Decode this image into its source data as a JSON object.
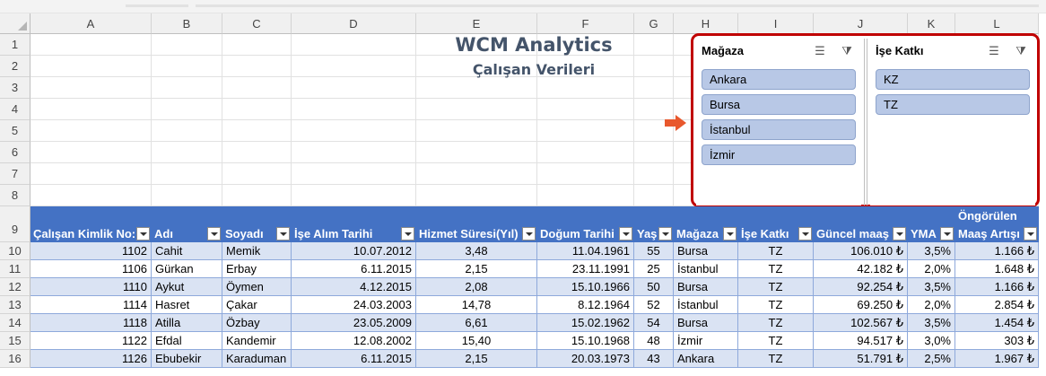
{
  "columns": [
    "A",
    "B",
    "C",
    "D",
    "E",
    "F",
    "G",
    "H",
    "I",
    "J",
    "K",
    "L"
  ],
  "rows": [
    "1",
    "2",
    "3",
    "4",
    "5",
    "6",
    "7",
    "8",
    "9",
    "10",
    "11",
    "12",
    "13",
    "14",
    "15",
    "16"
  ],
  "title": "WCM Analytics",
  "subtitle": "Çalışan Verileri",
  "slicers": [
    {
      "title": "Mağaza",
      "items": [
        "Ankara",
        "Bursa",
        "İstanbul",
        "İzmir"
      ]
    },
    {
      "title": "İşe Katkı",
      "items": [
        "KZ",
        "TZ"
      ]
    }
  ],
  "headers": [
    "Çalışan Kimlik No:",
    "Adı",
    "Soyadı",
    "İşe Alım Tarihi",
    "Hizmet Süresi(Yıl)",
    "Doğum Tarihi",
    "Yaş",
    "Mağaza",
    "İşe Katkı",
    "Güncel maaş",
    "YMA",
    "Maaş Artışı"
  ],
  "header_top_line": "Öngörülen",
  "table_rows": [
    [
      "1102",
      "Cahit",
      "Memik",
      "10.07.2012",
      "3,48",
      "11.04.1961",
      "55",
      "Bursa",
      "TZ",
      "106.010 ₺",
      "3,5%",
      "1.166 ₺"
    ],
    [
      "1106",
      "Gürkan",
      "Erbay",
      "6.11.2015",
      "2,15",
      "23.11.1991",
      "25",
      "İstanbul",
      "TZ",
      "42.182 ₺",
      "2,0%",
      "1.648 ₺"
    ],
    [
      "1110",
      "Aykut",
      "Öymen",
      "4.12.2015",
      "2,08",
      "15.10.1966",
      "50",
      "Bursa",
      "TZ",
      "92.254 ₺",
      "3,5%",
      "1.166 ₺"
    ],
    [
      "1114",
      "Hasret",
      "Çakar",
      "24.03.2003",
      "14,78",
      "8.12.1964",
      "52",
      "İstanbul",
      "TZ",
      "69.250 ₺",
      "2,0%",
      "2.854 ₺"
    ],
    [
      "1118",
      "Atilla",
      "Özbay",
      "23.05.2009",
      "6,61",
      "15.02.1962",
      "54",
      "Bursa",
      "TZ",
      "102.567 ₺",
      "3,5%",
      "1.454 ₺"
    ],
    [
      "1122",
      "Efdal",
      "Kandemir",
      "12.08.2002",
      "15,40",
      "15.10.1968",
      "48",
      "İzmir",
      "TZ",
      "94.517 ₺",
      "3,0%",
      "303 ₺"
    ],
    [
      "1126",
      "Ebubekir",
      "Karaduman",
      "6.11.2015",
      "2,15",
      "20.03.1973",
      "43",
      "Ankara",
      "TZ",
      "51.791 ₺",
      "2,5%",
      "1.967 ₺"
    ]
  ],
  "colors": {
    "table_header": "#4472c4",
    "band": "#dae3f3",
    "slicer_item": "#b8c8e6",
    "highlight_frame": "#c00000",
    "title": "#44546a",
    "arrow": "#e8582d"
  }
}
